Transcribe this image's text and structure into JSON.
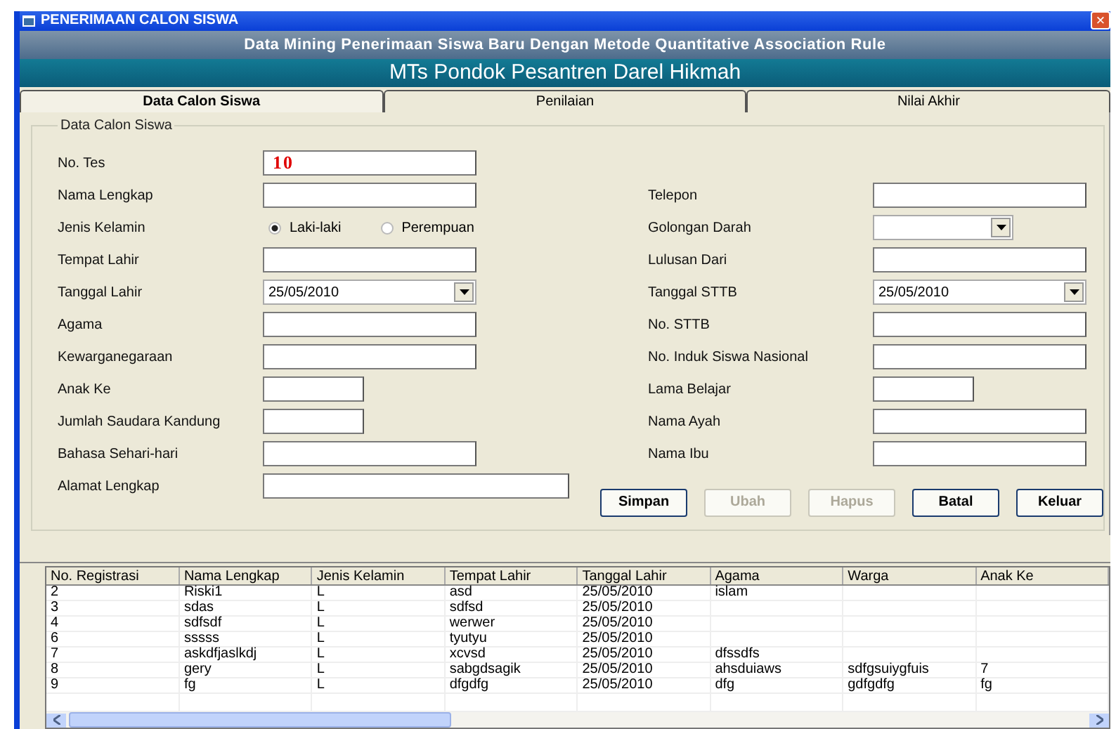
{
  "window": {
    "title": "PENERIMAAN CALON SISWA",
    "close": "×"
  },
  "header": {
    "subtitle": "Data Mining Penerimaan Siswa Baru Dengan Metode Quantitative Association Rule",
    "title": "MTs Pondok Pesantren Darel Hikmah"
  },
  "tabs": [
    {
      "label": "Data Calon Siswa",
      "selected": true
    },
    {
      "label": "Penilaian",
      "selected": false
    },
    {
      "label": "Nilai Akhir",
      "selected": false
    }
  ],
  "form": {
    "legend": "Data Calon Siswa",
    "left": [
      {
        "label": "No. Tes",
        "kind": "code",
        "value": "10"
      },
      {
        "label": "Nama Lengkap",
        "kind": "text"
      },
      {
        "label": "Jenis Kelamin",
        "kind": "radio",
        "options": [
          {
            "label": "Laki-laki",
            "selected": true
          },
          {
            "label": "Perempuan",
            "selected": false
          }
        ]
      },
      {
        "label": "Tempat Lahir",
        "kind": "text"
      },
      {
        "label": "Tanggal Lahir",
        "kind": "date",
        "value": "25/05/2010"
      },
      {
        "label": "Agama",
        "kind": "text"
      },
      {
        "label": "Kewarganegaraan",
        "kind": "text"
      },
      {
        "label": "Anak Ke",
        "kind": "short"
      },
      {
        "label": "Jumlah Saudara Kandung",
        "kind": "short"
      },
      {
        "label": "Bahasa Sehari-hari",
        "kind": "text"
      },
      {
        "label": "Alamat Lengkap",
        "kind": "long"
      }
    ],
    "right": [
      {
        "label": "Telepon",
        "kind": "text"
      },
      {
        "label": "Golongan Darah",
        "kind": "combo"
      },
      {
        "label": "Lulusan Dari",
        "kind": "text"
      },
      {
        "label": "Tanggal STTB",
        "kind": "date",
        "value": "25/05/2010"
      },
      {
        "label": "No. STTB",
        "kind": "text"
      },
      {
        "label": "No. Induk Siswa Nasional",
        "kind": "text"
      },
      {
        "label": "Lama Belajar",
        "kind": "short"
      },
      {
        "label": "Nama Ayah",
        "kind": "text"
      },
      {
        "label": "Nama Ibu",
        "kind": "text"
      }
    ]
  },
  "buttons": [
    {
      "label": "Simpan",
      "disabled": false
    },
    {
      "label": "Ubah",
      "disabled": true
    },
    {
      "label": "Hapus",
      "disabled": true
    },
    {
      "label": "Batal",
      "disabled": false
    },
    {
      "label": "Keluar",
      "disabled": false
    }
  ],
  "table": {
    "columns": [
      "No. Registrasi",
      "Nama Lengkap",
      "Jenis Kelamin",
      "Tempat Lahir",
      "Tanggal Lahir",
      "Agama",
      "Warga",
      "Anak Ke"
    ],
    "rows": [
      [
        "2",
        "Riski1",
        "L",
        "asd",
        "25/05/2010",
        "islam",
        null,
        null
      ],
      [
        "3",
        "sdas",
        "L",
        "sdfsd",
        "25/05/2010",
        null,
        null,
        null
      ],
      [
        "4",
        "sdfsdf",
        "L",
        "werwer",
        "25/05/2010",
        null,
        null,
        null
      ],
      [
        "6",
        "sssss",
        "L",
        "tyutyu",
        "25/05/2010",
        null,
        null,
        null
      ],
      [
        "7",
        "askdfjaslkdj",
        "L",
        "xcvsd",
        "25/05/2010",
        "dfssdfs",
        null,
        null
      ],
      [
        "8",
        "gery",
        "L",
        "sabgdsagik",
        "25/05/2010",
        "ahsduiaws",
        "sdfgsuiygfuis",
        "7"
      ],
      [
        "9",
        "fg",
        "L",
        "dfgdfg",
        "25/05/2010",
        "dfg",
        "gdfgdfg",
        "fg"
      ]
    ]
  }
}
